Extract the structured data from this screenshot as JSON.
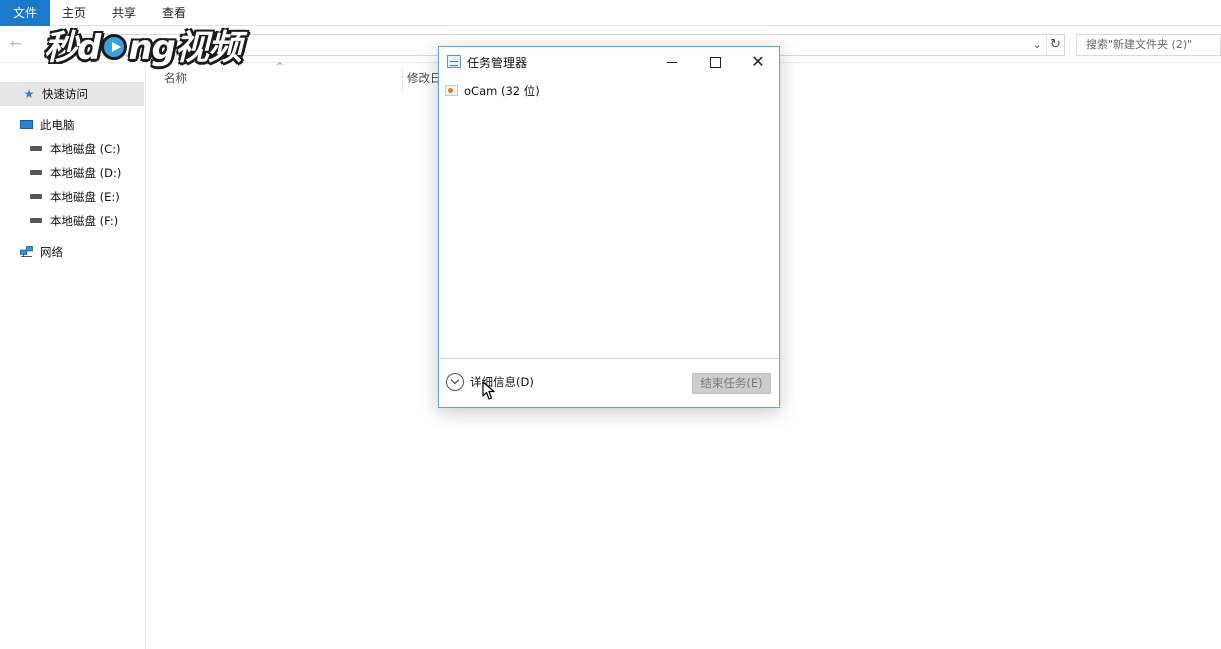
{
  "ribbon": {
    "tabs": [
      "文件",
      "主页",
      "共享",
      "查看"
    ]
  },
  "address": {
    "search_placeholder": "搜索\"新建文件夹 (2)\""
  },
  "watermark": {
    "text_before": "秒d",
    "text_after": "ng视频"
  },
  "sidebar": {
    "quick_access": "快速访问",
    "this_pc": "此电脑",
    "drives": [
      "本地磁盘 (C:)",
      "本地磁盘 (D:)",
      "本地磁盘 (E:)",
      "本地磁盘 (F:)"
    ],
    "network": "网络"
  },
  "columns": {
    "name": "名称",
    "modified": "修改日"
  },
  "task_manager": {
    "title": "任务管理器",
    "processes": [
      "oCam (32 位)"
    ],
    "more_details": "详细信息(D)",
    "end_task": "结束任务(E)"
  }
}
